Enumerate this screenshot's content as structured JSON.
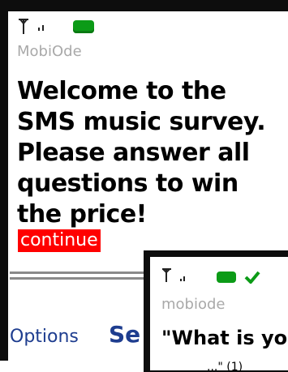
{
  "back_screen": {
    "app_name": "MobiOde",
    "message": "Welcome to the SMS music survey. Please answer all questions to win the price!",
    "continue_label": "continue",
    "softkeys": {
      "left_label": "Options",
      "center_label": "Se"
    },
    "colors": {
      "link_bg": "#ff0000",
      "softkey_text": "#1e3d8f",
      "battery": "#0c9b17"
    }
  },
  "front_screen": {
    "app_name": "mobiode",
    "question": "\"What is yo",
    "snippet": "...\" (1)"
  },
  "icons": [
    "antenna-icon",
    "signal-bars-icon",
    "battery-icon",
    "message-check-icon"
  ]
}
